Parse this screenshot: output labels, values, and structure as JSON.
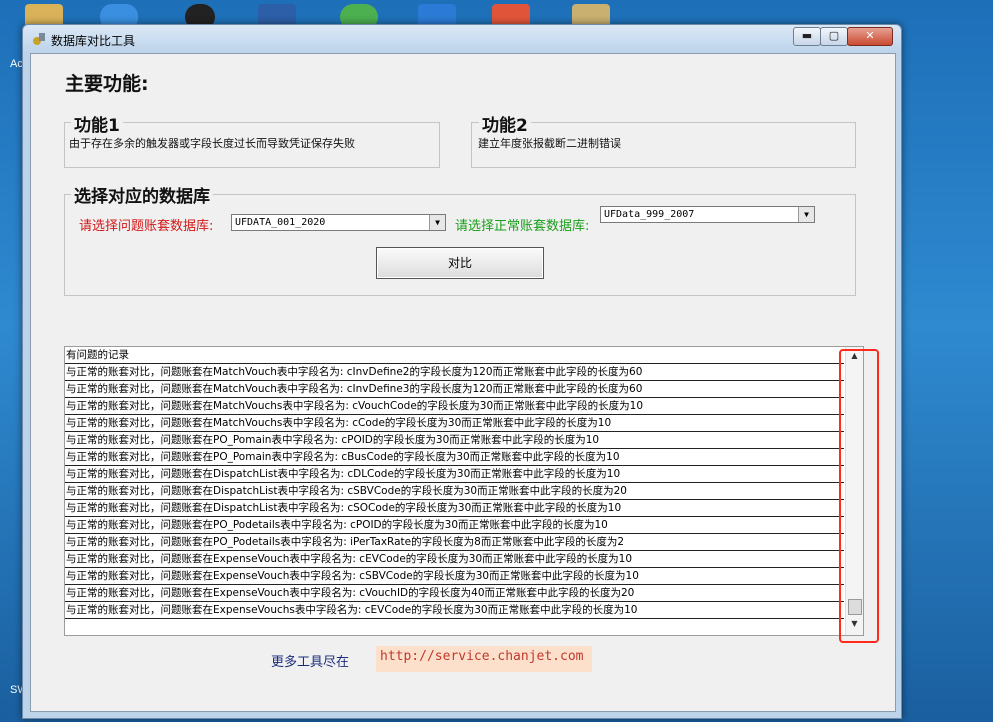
{
  "desktop": {
    "labels": [
      "Ac",
      "SW"
    ]
  },
  "window": {
    "title": "数据库对比工具",
    "controls": {
      "minimize": "▬",
      "maximize": "▢",
      "close": "✕"
    }
  },
  "main": {
    "heading": "主要功能:",
    "feature1": {
      "title": "功能1",
      "desc": "由于存在多余的触发器或字段长度过长而导致凭证保存失败"
    },
    "feature2": {
      "title": "功能2",
      "desc": "建立年度张报截断二进制错误"
    },
    "select_group": {
      "title": "选择对应的数据库",
      "problem_label": "请选择问题账套数据库:",
      "problem_value": "UFDATA_001_2020",
      "normal_label": "请选择正常账套数据库:",
      "normal_value": "UFData_999_2007",
      "compare_button": "对比"
    },
    "list": {
      "header": "有问题的记录",
      "rows": [
        "与正常的账套对比，问题账套在MatchVouch表中字段名为: cInvDefine2的字段长度为120而正常账套中此字段的长度为60",
        "与正常的账套对比，问题账套在MatchVouch表中字段名为: cInvDefine3的字段长度为120而正常账套中此字段的长度为60",
        "与正常的账套对比，问题账套在MatchVouchs表中字段名为: cVouchCode的字段长度为30而正常账套中此字段的长度为10",
        "与正常的账套对比，问题账套在MatchVouchs表中字段名为: cCode的字段长度为30而正常账套中此字段的长度为10",
        "与正常的账套对比，问题账套在PO_Pomain表中字段名为: cPOID的字段长度为30而正常账套中此字段的长度为10",
        "与正常的账套对比，问题账套在PO_Pomain表中字段名为: cBusCode的字段长度为30而正常账套中此字段的长度为10",
        "与正常的账套对比，问题账套在DispatchList表中字段名为: cDLCode的字段长度为30而正常账套中此字段的长度为10",
        "与正常的账套对比，问题账套在DispatchList表中字段名为: cSBVCode的字段长度为30而正常账套中此字段的长度为20",
        "与正常的账套对比，问题账套在DispatchList表中字段名为: cSOCode的字段长度为30而正常账套中此字段的长度为10",
        "与正常的账套对比，问题账套在PO_Podetails表中字段名为: cPOID的字段长度为30而正常账套中此字段的长度为10",
        "与正常的账套对比，问题账套在PO_Podetails表中字段名为: iPerTaxRate的字段长度为8而正常账套中此字段的长度为2",
        "与正常的账套对比，问题账套在ExpenseVouch表中字段名为: cEVCode的字段长度为30而正常账套中此字段的长度为10",
        "与正常的账套对比，问题账套在ExpenseVouch表中字段名为: cSBVCode的字段长度为30而正常账套中此字段的长度为10",
        "与正常的账套对比，问题账套在ExpenseVouch表中字段名为: cVouchID的字段长度为40而正常账套中此字段的长度为20",
        "与正常的账套对比，问题账套在ExpenseVouchs表中字段名为: cEVCode的字段长度为30而正常账套中此字段的长度为10"
      ]
    },
    "footer": {
      "more_tools": "更多工具尽在",
      "url": "http://service.chanjet.com"
    }
  },
  "colors": {
    "highlight": "#ff2a1a",
    "problem_label": "#d31818",
    "normal_label": "#1a9f1a",
    "url_bg": "#fde0cc"
  }
}
